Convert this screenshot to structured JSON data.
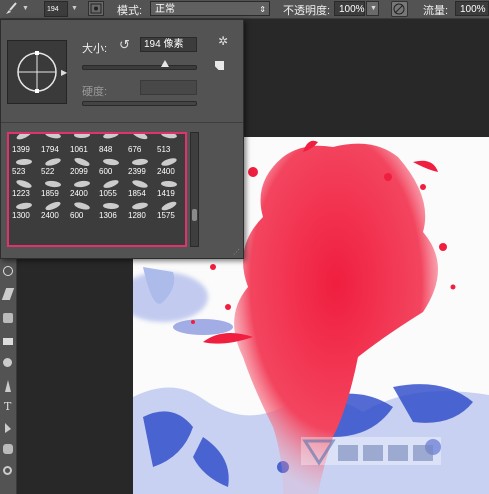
{
  "options_bar": {
    "brush_size": "194",
    "mode_label": "模式:",
    "mode_value": "正常",
    "opacity_label": "不透明度:",
    "opacity_value": "100%",
    "flow_label": "流量:",
    "flow_value": "100%"
  },
  "brush_panel": {
    "size_label": "大小:",
    "size_value": "194 像素",
    "hardness_label": "硬度:",
    "presets": [
      "1399",
      "1794",
      "1061",
      "848",
      "676",
      "513",
      "523",
      "522",
      "2099",
      "600",
      "2399",
      "2400",
      "1223",
      "1859",
      "2400",
      "1055",
      "1854",
      "1419",
      "1300",
      "2400",
      "600",
      "1306",
      "1280",
      "1575"
    ]
  },
  "colors": {
    "accent": "#e0336b",
    "splash_red": "#f01e3f",
    "splash_blue": "#2a48c8"
  }
}
